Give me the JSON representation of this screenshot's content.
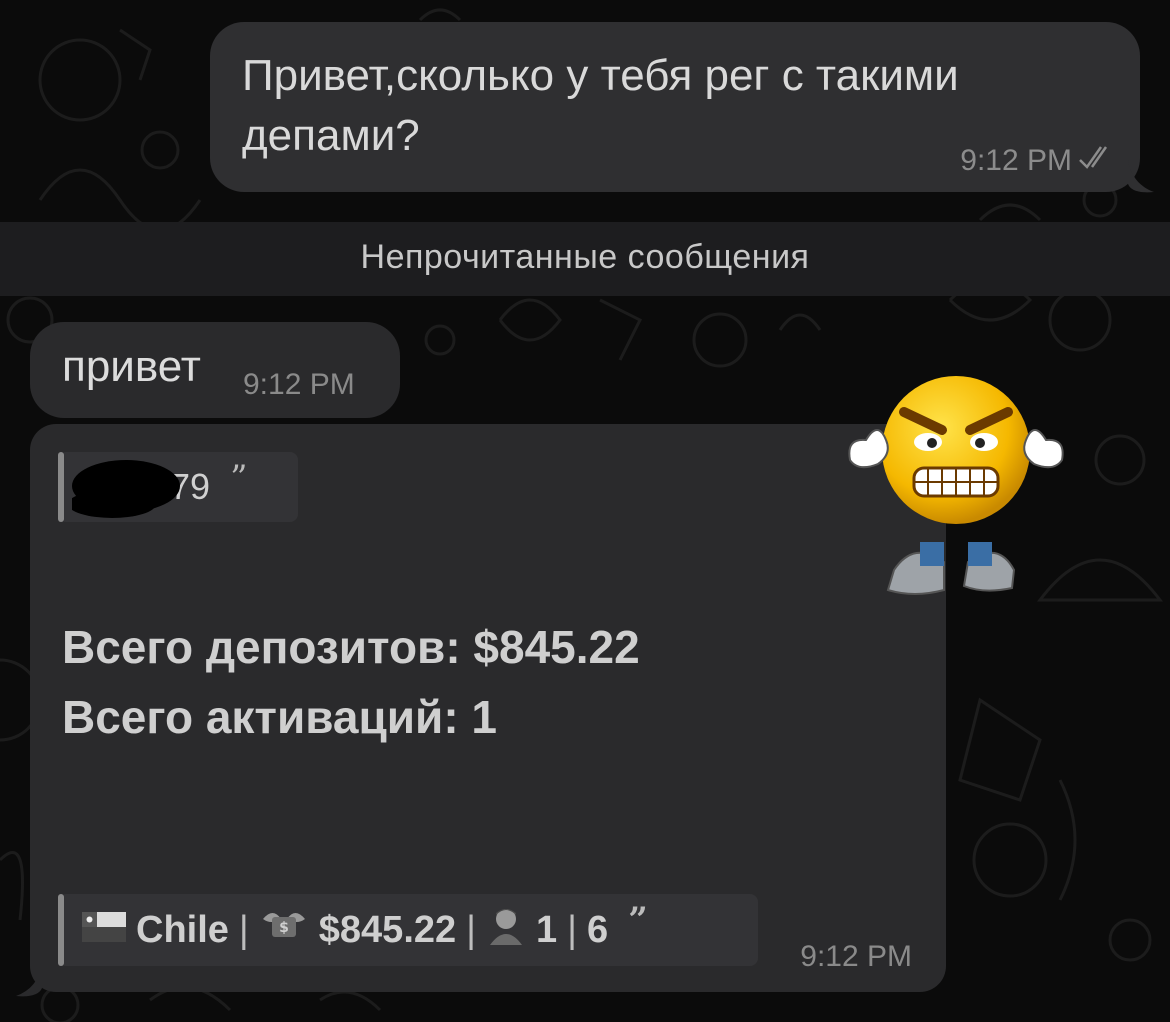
{
  "outgoing_message": {
    "text": "Привет,сколько у тебя рег с такими депами?",
    "time": "9:12 PM",
    "status_icon": "double-check-icon"
  },
  "unread_divider": {
    "label": "Непрочитанные сообщения"
  },
  "incoming_short": {
    "text": "привет",
    "time": "9:12 PM"
  },
  "incoming_stats": {
    "quoted_sender_visible": "579",
    "quote_mark": "”",
    "total_deposits": "Всего депозитов: $845.22",
    "total_activations": "Всего активаций: 1",
    "footer_quote": {
      "country": "Chile",
      "amount": "$845.22",
      "count_a": "1",
      "count_b": "6",
      "separator": "|",
      "icons": [
        "chile-flag-icon",
        "money-wings-icon",
        "person-icon"
      ]
    },
    "time": "9:12 PM"
  },
  "sticker": {
    "name": "angry-smiley-sticker"
  }
}
